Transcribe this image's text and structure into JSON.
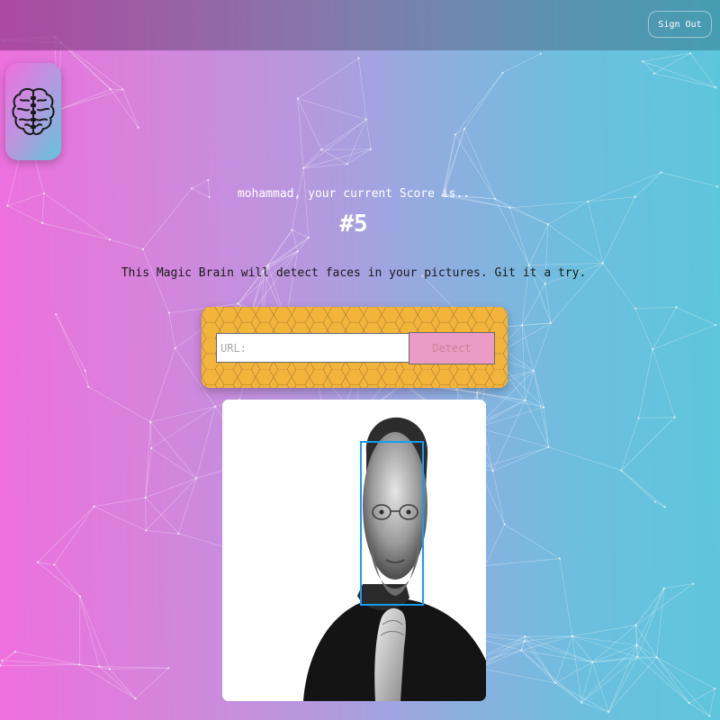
{
  "header": {
    "signout_label": "Sign Out"
  },
  "logo": {
    "icon": "brain-icon"
  },
  "rank": {
    "greeting": "mohammad, your current Score is..",
    "score": "#5"
  },
  "intro": {
    "text": "This Magic Brain will detect faces in your pictures. Git it a try."
  },
  "form": {
    "url_placeholder": "URL:",
    "url_value": "",
    "detect_label": "Detect"
  },
  "result": {
    "image": "portrait-photo",
    "detected_faces": 1
  },
  "colors": {
    "gradient_start": "#ee6fde",
    "gradient_end": "#5ec6dc",
    "form_panel": "#f3b43c",
    "detect_button": "#ea9bc6",
    "face_box": "#149df2"
  }
}
